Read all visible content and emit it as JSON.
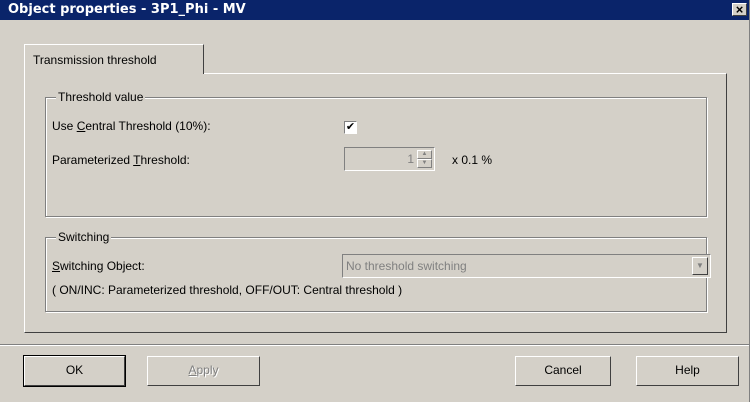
{
  "window": {
    "title": "Object properties - 3P1_Phi - MV",
    "close_glyph": "×"
  },
  "tabs": [
    {
      "label": "Transmission threshold",
      "active": true
    }
  ],
  "threshold_group": {
    "title": "Threshold value",
    "central": {
      "pre": "Use ",
      "accel": "C",
      "post": "entral Threshold (10%):",
      "checked": true,
      "check_glyph": "✔"
    },
    "param": {
      "pre": "Parameterized ",
      "accel": "T",
      "post": "hreshold:",
      "value": "1",
      "unit": "x 0.1 %",
      "enabled": false
    }
  },
  "switching_group": {
    "title": "Switching",
    "object": {
      "pre": "",
      "accel": "S",
      "post": "witching Object:",
      "selected": "No threshold switching",
      "enabled": false
    },
    "note": "( ON/INC: Parameterized threshold, OFF/OUT: Central threshold )"
  },
  "buttons": {
    "ok": "OK",
    "apply_accel": "A",
    "apply_rest": "pply",
    "cancel": "Cancel",
    "help": "Help"
  },
  "icons": {
    "spin_up": "up-arrow-icon",
    "spin_down": "down-arrow-icon",
    "combo": "dropdown-arrow-icon"
  }
}
